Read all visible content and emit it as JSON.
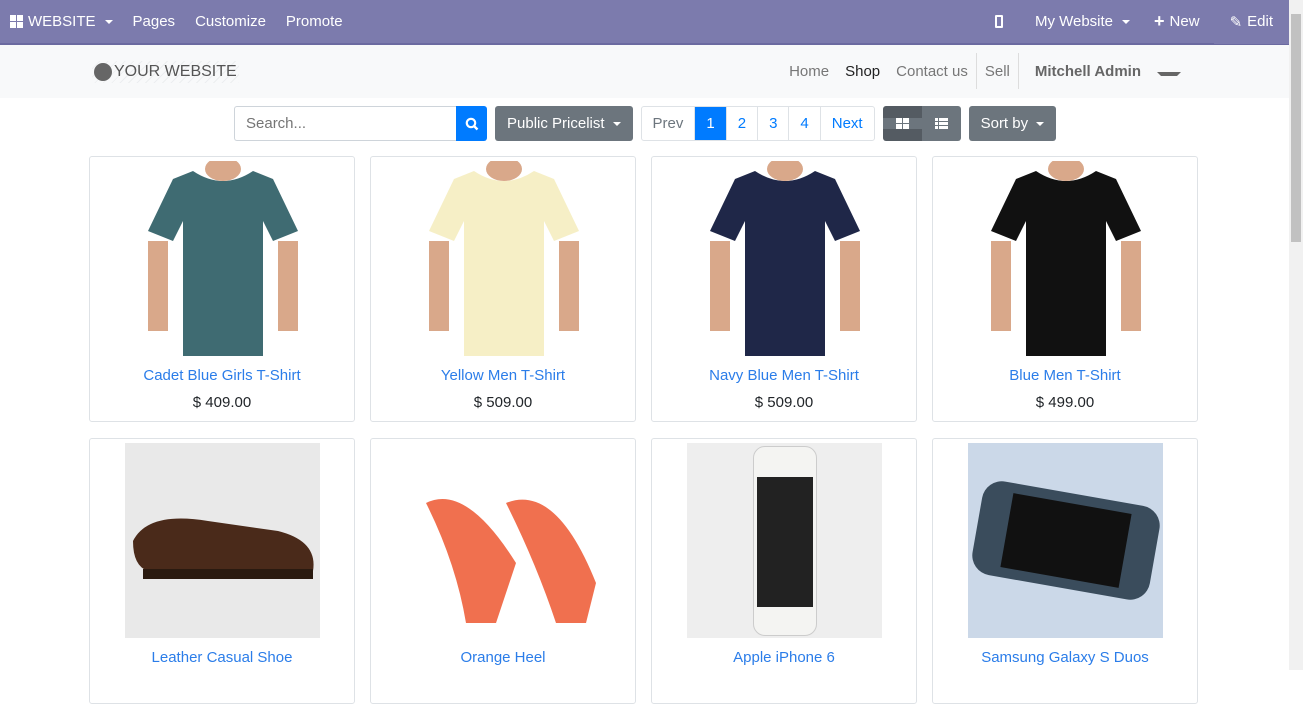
{
  "topbar": {
    "app": "WEBSITE",
    "items": [
      "Pages",
      "Customize",
      "Promote"
    ],
    "website": "My Website",
    "new": "New",
    "edit": "Edit"
  },
  "header": {
    "logo": "YOUR WEBSITE",
    "nav": [
      "Home",
      "Shop",
      "Contact us"
    ],
    "sell": "Sell",
    "user": "Mitchell Admin"
  },
  "toolbar": {
    "search_placeholder": "Search...",
    "pricelist": "Public Pricelist",
    "prev": "Prev",
    "pages": [
      "1",
      "2",
      "3",
      "4"
    ],
    "next": "Next",
    "sort": "Sort by"
  },
  "products": [
    {
      "name": "Cadet Blue Girls T-Shirt",
      "price": "$ 409.00",
      "color": "#3f6b72"
    },
    {
      "name": "Yellow Men T-Shirt",
      "price": "$ 509.00",
      "color": "#f6efc6"
    },
    {
      "name": "Navy Blue Men T-Shirt",
      "price": "$ 509.00",
      "color": "#1f2748"
    },
    {
      "name": "Blue Men T-Shirt",
      "price": "$ 499.00",
      "color": "#111111"
    },
    {
      "name": "Leather Casual Shoe",
      "color": "#4a2a1a"
    },
    {
      "name": "Orange Heel",
      "color": "#f0704f"
    },
    {
      "name": "Apple iPhone 6",
      "color": "#222222"
    },
    {
      "name": "Samsung Galaxy S Duos",
      "color": "#3a4c5c"
    }
  ]
}
